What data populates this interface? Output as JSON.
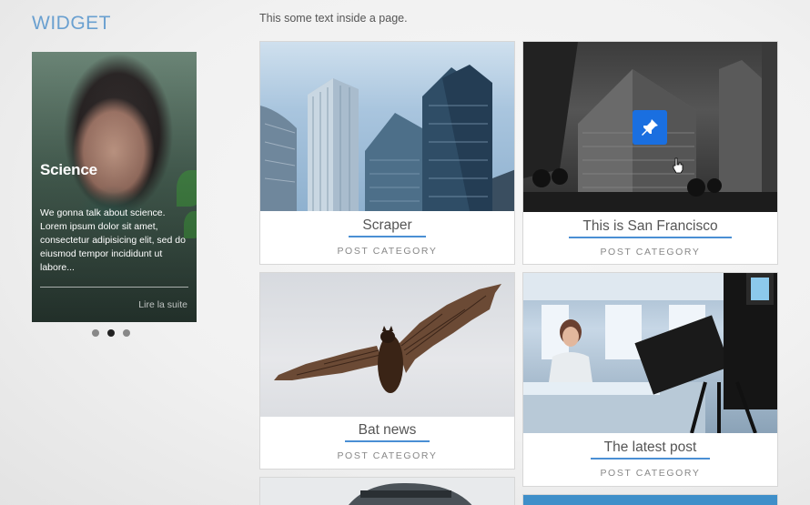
{
  "sidebar": {
    "widget_title": "WIDGET",
    "slide": {
      "title": "Science",
      "body": "We gonna talk about science. Lorem ipsum dolor sit amet, consectetur adipisicing elit, sed do eiusmod tempor incididunt ut labore...",
      "more_label": "Lire la suite"
    },
    "pagination": {
      "count": 3,
      "active_index": 1
    }
  },
  "main": {
    "intro": "This some text inside a page.",
    "posts": [
      {
        "title": "Scraper",
        "category": "POST CATEGORY",
        "image": "skyscraper-photo"
      },
      {
        "title": "This is San Francisco",
        "category": "POST CATEGORY",
        "image": "san-francisco-photo",
        "overlay_icon": "pin-icon"
      },
      {
        "title": "Bat news",
        "category": "POST CATEGORY",
        "image": "bat-photo"
      },
      {
        "title": "The latest post",
        "category": "POST CATEGORY",
        "image": "news-studio-photo"
      }
    ]
  },
  "colors": {
    "accent": "#4a8fd4",
    "widget_title": "#6aa0d0",
    "pin_button": "#1a6fe0"
  }
}
